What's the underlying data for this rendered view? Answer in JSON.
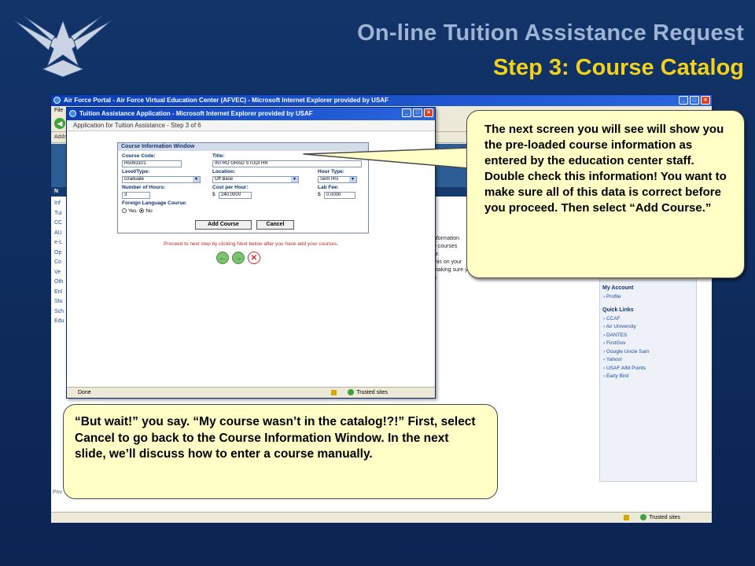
{
  "slide": {
    "title_line1": "On-line Tuition Assistance Request",
    "title_line2": "Step 3: Course Catalog",
    "logo": "air-force-symbol"
  },
  "outer_window": {
    "title": "Air Force Portal - Air Force Virtual Education Center (AFVEC) - Microsoft Internet Explorer provided by USAF",
    "menu_fragment": "File",
    "address_fragment": "Addr",
    "nav_fragment": "N",
    "left_menu": [
      "Inf",
      "Tui",
      "CC",
      "AU",
      "e-L",
      "Op",
      "Co",
      "Ve",
      "Oth",
      "Enl",
      "Stu",
      "Sch",
      "Edu"
    ],
    "main_fragments": [
      "nformation",
      "e courses",
      "ur.",
      "this on your",
      "making sure your application for tuition assistance",
      "n"
    ],
    "right_panel": {
      "items_top": [
        "My CCAF Actions",
        "My Test Scores",
        "My CCAF Apps",
        "Apply for TA"
      ],
      "account_heading": "My Account",
      "account_items": [
        "Profile"
      ],
      "links_heading": "Quick Links",
      "links": [
        "CCAF",
        "Air University",
        "DANTES",
        "FirstGov",
        "Google Uncle Sam",
        "Yahoo!",
        "USAF AIM Points",
        "Early Bird"
      ]
    },
    "privacy_fragment": "Priv",
    "status_zone": "Trusted sites"
  },
  "inner_window": {
    "title": "Tuition Assistance Application - Microsoft Internet Explorer provided by USAF",
    "page_heading": "Application for Tuition Assistance - Step 3 of 6",
    "course_window": {
      "title": "Course Information Window",
      "course_code_label": "Course Code:",
      "course_code_value": "H5093101",
      "title_label": "Title:",
      "title_value": "INTRO GRAD STUDI HR",
      "level_label": "Level/Type:",
      "level_value": "Graduate",
      "location_label": "Location:",
      "location_value": "Off Base",
      "hour_type_label": "Hour Type:",
      "hour_type_value": "Sem Hrs",
      "hours_label": "Number of Hours:",
      "hours_value": "3",
      "cost_label": "Cost per Hour:",
      "cost_currency": "$",
      "cost_value": "240.0000",
      "labfee_label": "Lab Fee:",
      "labfee_currency": "$",
      "labfee_value": "0.0000",
      "foreign_label": "Foreign Language Course:",
      "foreign_yes": "Yes",
      "foreign_no": "No",
      "foreign_selected": "No",
      "add_button": "Add Course",
      "cancel_button": "Cancel"
    },
    "proceed_text": "Proceed to next step by clicking Next below after you have add your courses.",
    "status_text": "Done",
    "status_zone": "Trusted sites"
  },
  "callouts": {
    "top_right": "The next screen you will see will show you the pre-loaded course information as entered by the education center staff.  Double check this information!  You want to make sure all of this data is correct before you proceed.  Then select “Add Course.”",
    "bottom_left": "“But wait!” you say.  “My course wasn’t in the catalog!?!”  First, select Cancel to go back to the Course Information Window.  In the next slide, we’ll discuss how to enter a course manually."
  }
}
